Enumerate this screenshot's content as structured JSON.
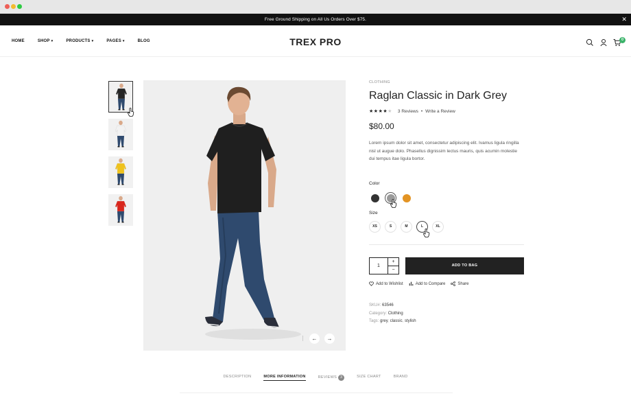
{
  "announcement": {
    "text": "Free Ground Shipping on All Us Orders Over $75.",
    "close_glyph": "✕"
  },
  "nav": {
    "items": [
      {
        "label": "HOME",
        "has_dropdown": false
      },
      {
        "label": "SHOP",
        "has_dropdown": true
      },
      {
        "label": "PRODUCTS",
        "has_dropdown": true
      },
      {
        "label": "PAGES",
        "has_dropdown": true
      },
      {
        "label": "BLOG",
        "has_dropdown": false
      }
    ],
    "logo": "TREX PRO",
    "icons": [
      "search-icon",
      "user-icon",
      "cart-icon"
    ],
    "cart_count": "0"
  },
  "thumbnails": [
    {
      "shirt_color": "#262626",
      "active": true
    },
    {
      "shirt_color": "#f2f2f2",
      "active": false
    },
    {
      "shirt_color": "#efc21c",
      "active": false
    },
    {
      "shirt_color": "#d9261c",
      "active": false
    }
  ],
  "gallery": {
    "prev_icon": "arrow-left-icon",
    "next_icon": "arrow-right-icon"
  },
  "product": {
    "category": "CLOTHING",
    "title": "Raglan Classic in Dark Grey",
    "rating": 4,
    "rating_max": 5,
    "reviews_text": "3 Reviews",
    "write_review": "Write a Review",
    "price": "$80.00",
    "description": "Lorem ipsum dolor sit amet, consectetur adipiscing elit. Ivamus ligula ringilla nisl ut augue dolo. Phasellus dignissim lectus mauris, quis acumin molestie dui tempus itae ligula bortor.",
    "color_label": "Color",
    "colors": [
      {
        "value": "#333333",
        "selected": false
      },
      {
        "value": "#9a9a9a",
        "selected": true
      },
      {
        "value": "#e39424",
        "selected": false
      }
    ],
    "size_label": "Size",
    "sizes": [
      {
        "label": "XS",
        "selected": false
      },
      {
        "label": "S",
        "selected": false
      },
      {
        "label": "M",
        "selected": false
      },
      {
        "label": "L",
        "selected": true
      },
      {
        "label": "XL",
        "selected": false
      }
    ],
    "quantity": "1",
    "qty_plus": "+",
    "qty_minus": "−",
    "add_to_bag": "ADD TO BAG",
    "actions": {
      "wishlist": "Add to Wishlist",
      "compare": "Add to Compare",
      "share": "Share"
    },
    "meta": {
      "sku_label": "SKU#:",
      "sku": "63546",
      "category_label": "Category:",
      "category": "Clothing",
      "tags_label": "Tags:",
      "tags": [
        "grey",
        "classic",
        "stylish"
      ]
    }
  },
  "tabs": [
    {
      "label": "DESCRIPTION",
      "active": false
    },
    {
      "label": "MORE INFORMATION",
      "active": true
    },
    {
      "label": "REVIEWS",
      "active": false,
      "badge": "3"
    },
    {
      "label": "SIZE CHART",
      "active": false
    },
    {
      "label": "BRAND",
      "active": false
    }
  ],
  "colors": {
    "accent": "#222222",
    "cart_badge": "#3bb36a",
    "announcement_bg": "#111111"
  }
}
